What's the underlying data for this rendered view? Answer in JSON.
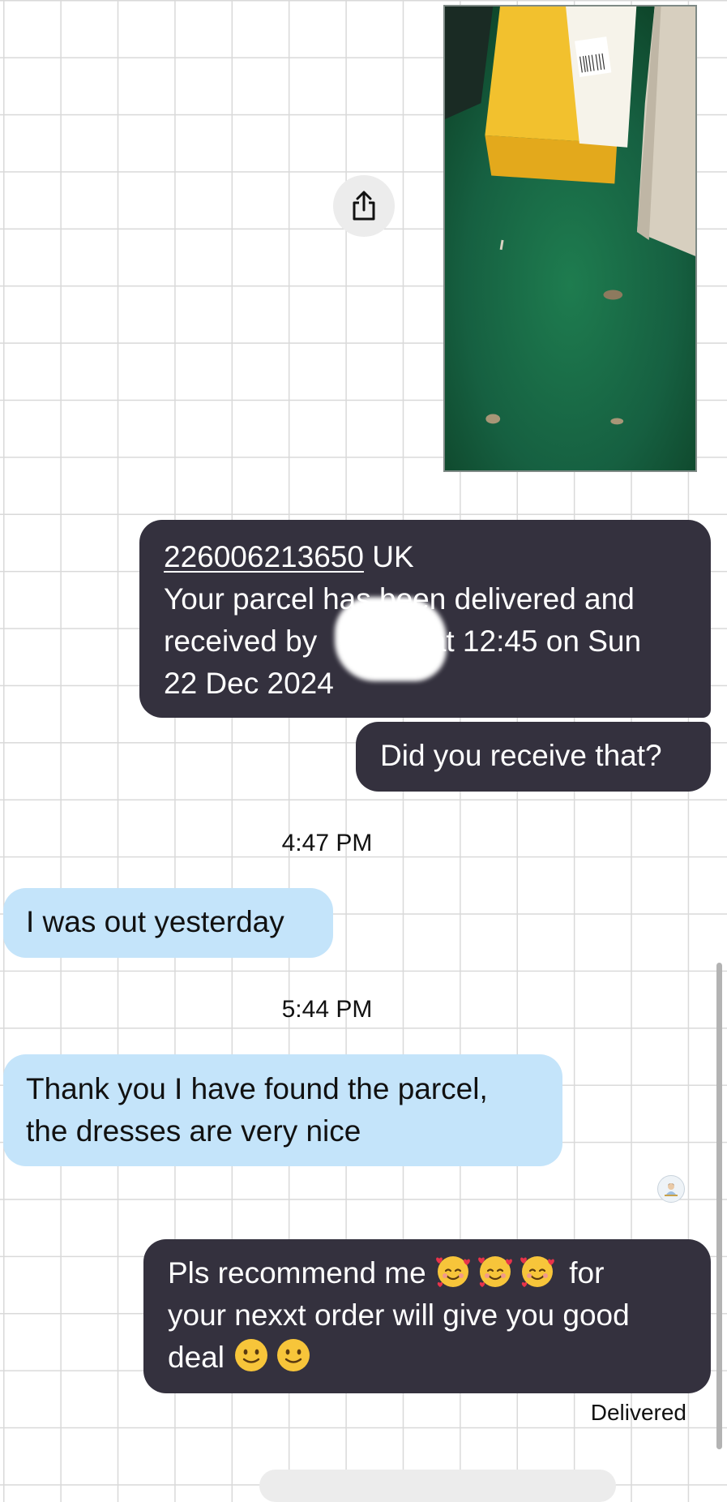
{
  "photo": {
    "alt": "Parcel on green mat",
    "icon": "parcel-photo"
  },
  "share_button": {
    "icon": "share-icon"
  },
  "messages": [
    {
      "direction": "outgoing",
      "tracking_number": "226006213650",
      "tracking_suffix": " UK",
      "line2": "Your parcel has been delivered and",
      "line3": "received by ",
      "line3_rest": " at 12:45 on Sun",
      "line4": "22 Dec 2024"
    },
    {
      "direction": "outgoing",
      "text": "Did you receive that?"
    },
    {
      "direction": "incoming",
      "text": "I was out yesterday"
    },
    {
      "direction": "incoming",
      "line1": "Thank you I have found the parcel,",
      "line2": "the dresses are very nice"
    },
    {
      "direction": "outgoing",
      "line1_pre": "Pls recommend me ",
      "line1_post": " for",
      "line2": "your nexxt order will give you good",
      "line3_pre": "deal ",
      "emoji_hearts": "smiling-face-with-hearts",
      "emoji_smile": "slightly-smiling-face"
    }
  ],
  "timestamps": [
    "4:47 PM",
    "5:44 PM"
  ],
  "status": "Delivered",
  "colors": {
    "outgoing_bubble": "#34313e",
    "incoming_bubble": "#c4e4fa",
    "grid": "#d9d9d9"
  }
}
